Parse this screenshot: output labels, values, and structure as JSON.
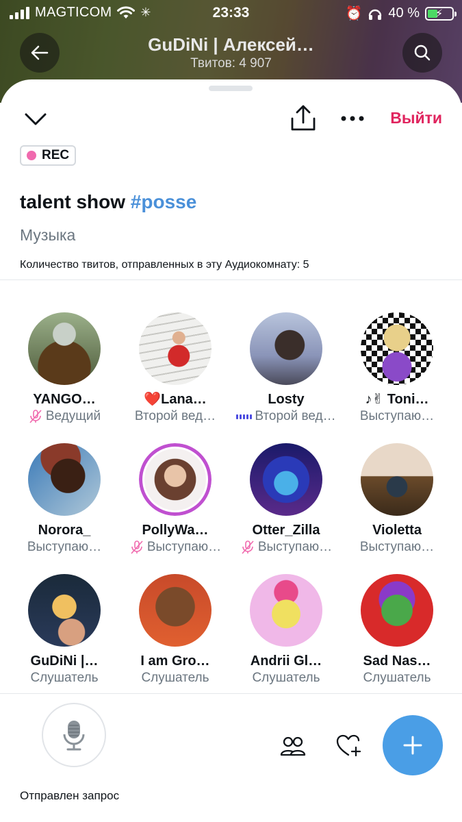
{
  "status_bar": {
    "carrier": "MAGTICOM",
    "time": "23:33",
    "battery": "40 %",
    "battery_level": 0.4
  },
  "profile_header": {
    "title": "GuDiNi | Алексей…",
    "subtitle": "Твитов: 4 907"
  },
  "space": {
    "leave_label": "Выйти",
    "rec_label": "REC",
    "title_text": "talent show ",
    "title_hashtag": "#posse",
    "topic": "Музыка",
    "tweet_count_text": "Количество твитов, отправленных в эту Аудиокомнату: 5"
  },
  "participants": [
    {
      "name": "YANGO…",
      "role": "Ведущий",
      "muted": true,
      "speaking": false
    },
    {
      "name": "❤️Lana…",
      "role": "Второй вед…",
      "muted": false,
      "speaking": false
    },
    {
      "name": "Losty",
      "role": "Второй вед…",
      "muted": false,
      "speaking": true
    },
    {
      "name": "♪✌ Toni…",
      "role": "Выступаю…",
      "muted": false,
      "speaking": false
    },
    {
      "name": "Norora_",
      "role": "Выступаю…",
      "muted": false,
      "speaking": false
    },
    {
      "name": "PollyWa…",
      "role": "Выступаю…",
      "muted": true,
      "speaking": false
    },
    {
      "name": "Otter_Zilla",
      "role": "Выступаю…",
      "muted": true,
      "speaking": false
    },
    {
      "name": "Violetta",
      "role": "Выступаю…",
      "muted": false,
      "speaking": false
    },
    {
      "name": "GuDiNi |…",
      "role": "Слушатель",
      "muted": false,
      "speaking": false
    },
    {
      "name": "I am Gro…",
      "role": "Слушатель",
      "muted": false,
      "speaking": false
    },
    {
      "name": "Andrii Gl…",
      "role": "Слушатель",
      "muted": false,
      "speaking": false
    },
    {
      "name": "Sad Nas…",
      "role": "Слушатель",
      "muted": false,
      "speaking": false
    }
  ],
  "bottom_bar": {
    "request_label": "Отправлен запрос"
  },
  "colors": {
    "accent_blue": "#4a9ee6",
    "leave_red": "#e0245e",
    "rec_dot": "#f06aae",
    "muted_pink": "#f06aae"
  }
}
